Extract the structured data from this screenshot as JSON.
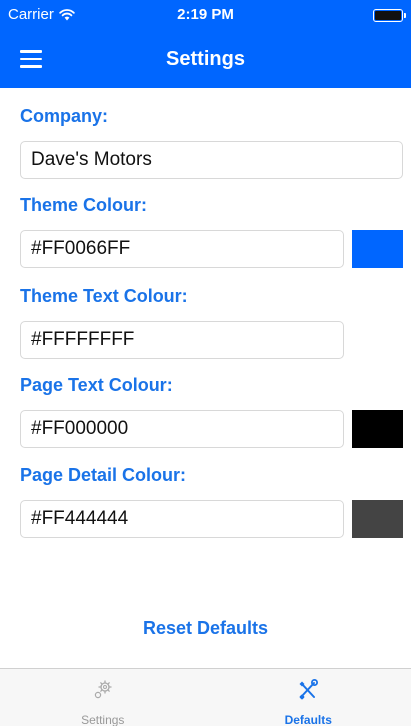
{
  "status_bar": {
    "carrier": "Carrier",
    "time": "2:19 PM"
  },
  "nav_bar": {
    "title": "Settings",
    "menu_icon": "hamburger-menu-icon"
  },
  "company": {
    "label": "Company:",
    "value": "Dave's Motors"
  },
  "theme_colour": {
    "label": "Theme Colour:",
    "value": "#FF0066FF",
    "swatch": "#0066FF"
  },
  "theme_text_colour": {
    "label": "Theme Text Colour:",
    "value": "#FFFFFFFF"
  },
  "page_text_colour": {
    "label": "Page Text Colour:",
    "value": "#FF000000",
    "swatch": "#000000"
  },
  "page_detail_colour": {
    "label": "Page Detail Colour:",
    "value": "#FF444444",
    "swatch": "#444444"
  },
  "reset_button": {
    "label": "Reset Defaults"
  },
  "tab_bar": {
    "tabs": [
      {
        "label": "Settings",
        "icon": "gears-icon",
        "active": false
      },
      {
        "label": "Defaults",
        "icon": "tools-icon",
        "active": true
      }
    ]
  },
  "colors": {
    "accent": "#1A73E8",
    "theme": "#0066FF"
  }
}
